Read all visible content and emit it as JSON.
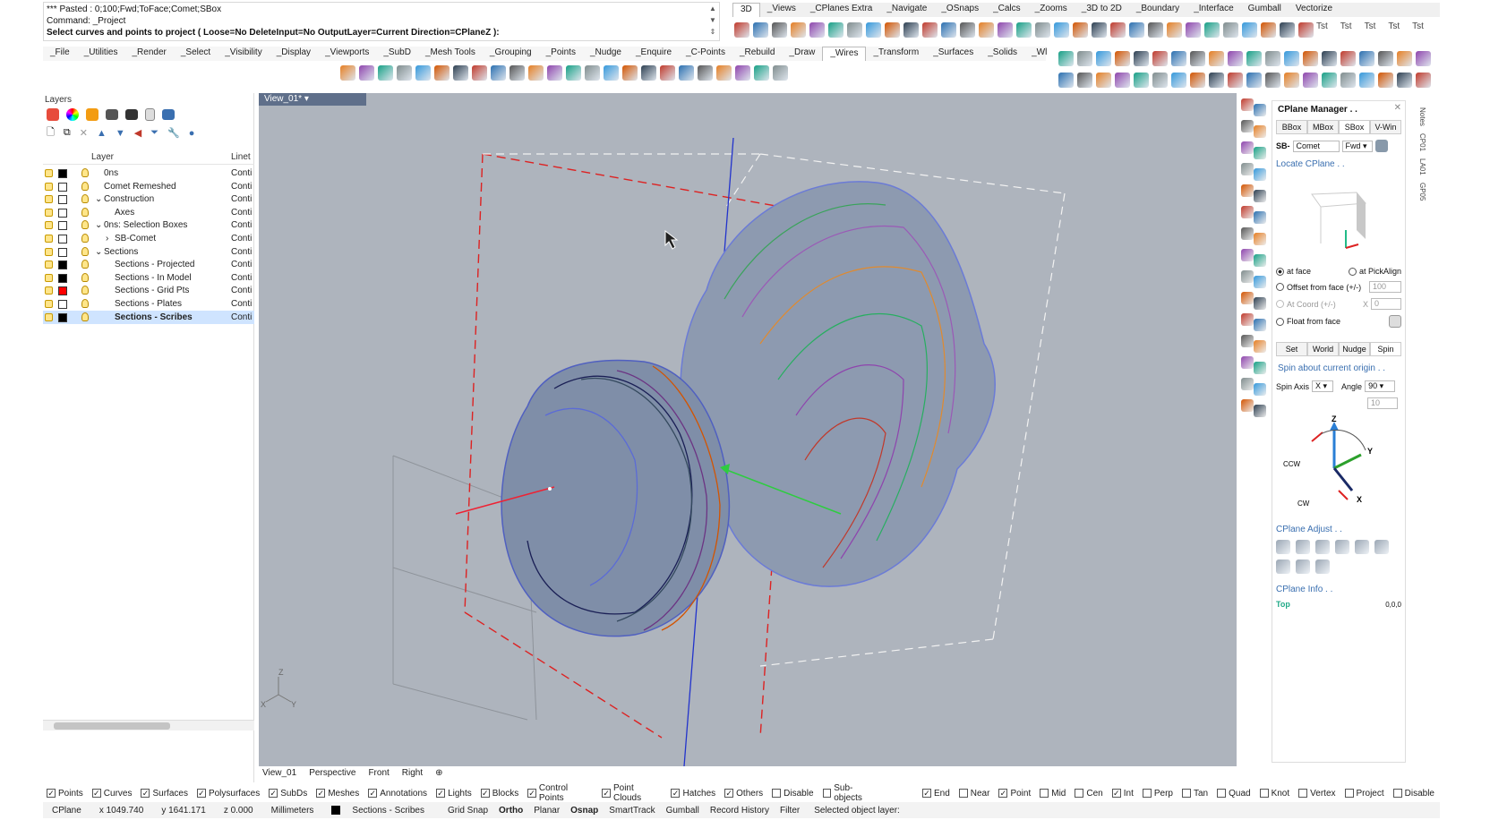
{
  "command": {
    "line1": "*** Pasted : 0;100;Fwd;ToFace;Comet;SBox",
    "line2": "Command: _Project",
    "prompt": "Select curves and points to project ( Loose=No  DeleteInput=No  OutputLayer=Current  Direction=CPlaneZ ):"
  },
  "top_tabs": [
    "3D",
    "_Views",
    "_CPlanes Extra",
    "_Navigate",
    "_OSnaps",
    "_Calcs",
    "_Zooms",
    "_3D to 2D",
    "_Boundary",
    "_Interface",
    "Gumball",
    "Vectorize"
  ],
  "main_tabs": [
    "_File",
    "_Utilities",
    "_Render",
    "_Select",
    "_Visibility",
    "_Display",
    "_Viewports",
    "_SubD",
    "_Mesh Tools",
    "_Grouping",
    "_Points",
    "_Nudge",
    "_Enquire",
    "_C-Points",
    "_Rebuild",
    "_Draw",
    "_Wires",
    "_Transform",
    "_Surfaces",
    "_Solids",
    "_Wl"
  ],
  "toolbar_tst": [
    "Tst",
    "Tst",
    "Tst",
    "Tst",
    "Tst"
  ],
  "layers": {
    "title": "Layers",
    "col_layer": "Layer",
    "col_linetype": "Linet",
    "rows": [
      {
        "name": "0ns",
        "indent": 0,
        "color": "#000000",
        "linetype": "Conti"
      },
      {
        "name": "Comet Remeshed",
        "indent": 0,
        "color": "#ffffff",
        "linetype": "Conti"
      },
      {
        "name": "Construction",
        "indent": 0,
        "color": "#ffffff",
        "linetype": "Conti",
        "expander": "v"
      },
      {
        "name": "Axes",
        "indent": 1,
        "color": "#ffffff",
        "linetype": "Conti"
      },
      {
        "name": "0ns: Selection Boxes",
        "indent": 0,
        "color": "#ffffff",
        "linetype": "Conti",
        "expander": "v"
      },
      {
        "name": "SB-Comet",
        "indent": 1,
        "color": "#ffffff",
        "linetype": "Conti",
        "expander": ">"
      },
      {
        "name": "Sections",
        "indent": 0,
        "color": "#ffffff",
        "linetype": "Conti",
        "expander": "v"
      },
      {
        "name": "Sections - Projected",
        "indent": 1,
        "color": "#000000",
        "linetype": "Conti"
      },
      {
        "name": "Sections - In Model",
        "indent": 1,
        "color": "#000000",
        "linetype": "Conti"
      },
      {
        "name": "Sections - Grid Pts",
        "indent": 1,
        "color": "#ff0000",
        "linetype": "Conti"
      },
      {
        "name": "Sections - Plates",
        "indent": 1,
        "color": "#ffffff",
        "linetype": "Conti"
      },
      {
        "name": "Sections - Scribes",
        "indent": 1,
        "color": "#000000",
        "linetype": "Conti",
        "selected": true
      }
    ]
  },
  "viewport": {
    "title": "View_01*",
    "tabs": [
      "View_01",
      "Perspective",
      "Front",
      "Right"
    ],
    "axis_z": "Z",
    "axis_x": "X",
    "axis_y": "Y"
  },
  "cplane": {
    "title": "CPlane Manager . .",
    "tabs": [
      "BBox",
      "MBox",
      "SBox",
      "V-Win"
    ],
    "prefix": "SB-",
    "name_value": "Comet",
    "dir_value": "Fwd",
    "locate_link": "Locate CPlane . .",
    "opt_at_face": "at face",
    "opt_pickalign": "at PickAlign",
    "opt_offset": "Offset from face (+/-)",
    "offset_value": "100",
    "opt_coord": "At Coord (+/-)",
    "coord_axis": "X",
    "coord_value": "0",
    "opt_float": "Float from face",
    "sub_tabs": [
      "Set",
      "World",
      "Nudge",
      "Spin"
    ],
    "spin_link": "Spin about current origin . .",
    "spin_axis_label": "Spin Axis",
    "spin_axis_value": "X",
    "angle_label": "Angle",
    "angle_value": "90",
    "step_value": "10",
    "gizmo_z": "Z",
    "gizmo_y": "Y",
    "gizmo_x": "X",
    "gizmo_ccw": "CCW",
    "gizmo_cw": "CW",
    "adjust_link": "CPlane Adjust . .",
    "info_link": "CPlane Info . .",
    "info_top": "Top",
    "info_origin": "0,0,0"
  },
  "side_tabs": [
    "Notes",
    "CP01",
    "LA01",
    "GP05"
  ],
  "filters": [
    {
      "label": "Points",
      "checked": true
    },
    {
      "label": "Curves",
      "checked": true
    },
    {
      "label": "Surfaces",
      "checked": true
    },
    {
      "label": "Polysurfaces",
      "checked": true
    },
    {
      "label": "SubDs",
      "checked": true
    },
    {
      "label": "Meshes",
      "checked": true
    },
    {
      "label": "Annotations",
      "checked": true
    },
    {
      "label": "Lights",
      "checked": true
    },
    {
      "label": "Blocks",
      "checked": true
    },
    {
      "label": "Control Points",
      "checked": true
    },
    {
      "label": "Point Clouds",
      "checked": true
    },
    {
      "label": "Hatches",
      "checked": true
    },
    {
      "label": "Others",
      "checked": true
    },
    {
      "label": "Disable",
      "checked": false
    },
    {
      "label": "Sub-objects",
      "checked": false
    }
  ],
  "osnaps": [
    {
      "label": "End",
      "checked": true
    },
    {
      "label": "Near",
      "checked": false
    },
    {
      "label": "Point",
      "checked": true
    },
    {
      "label": "Mid",
      "checked": false
    },
    {
      "label": "Cen",
      "checked": false
    },
    {
      "label": "Int",
      "checked": true
    },
    {
      "label": "Perp",
      "checked": false
    },
    {
      "label": "Tan",
      "checked": false
    },
    {
      "label": "Quad",
      "checked": false
    },
    {
      "label": "Knot",
      "checked": false
    },
    {
      "label": "Vertex",
      "checked": false
    },
    {
      "label": "Project",
      "checked": false
    },
    {
      "label": "Disable",
      "checked": false
    }
  ],
  "status": {
    "cplane": "CPlane",
    "x": "x 1049.740",
    "y": "y 1641.171",
    "z": "z 0.000",
    "units": "Millimeters",
    "layer": "Sections - Scribes",
    "toggles": [
      {
        "label": "Grid Snap",
        "bold": false
      },
      {
        "label": "Ortho",
        "bold": true
      },
      {
        "label": "Planar",
        "bold": false
      },
      {
        "label": "Osnap",
        "bold": true
      },
      {
        "label": "SmartTrack",
        "bold": false
      },
      {
        "label": "Gumball",
        "bold": false
      },
      {
        "label": "Record History",
        "bold": false
      },
      {
        "label": "Filter",
        "bold": false
      }
    ],
    "message": "Selected object layer:"
  },
  "colors": {
    "viewport_bg": "#aeb4bd",
    "selection": "#cfe4ff",
    "accent": "#3a6fb0"
  }
}
